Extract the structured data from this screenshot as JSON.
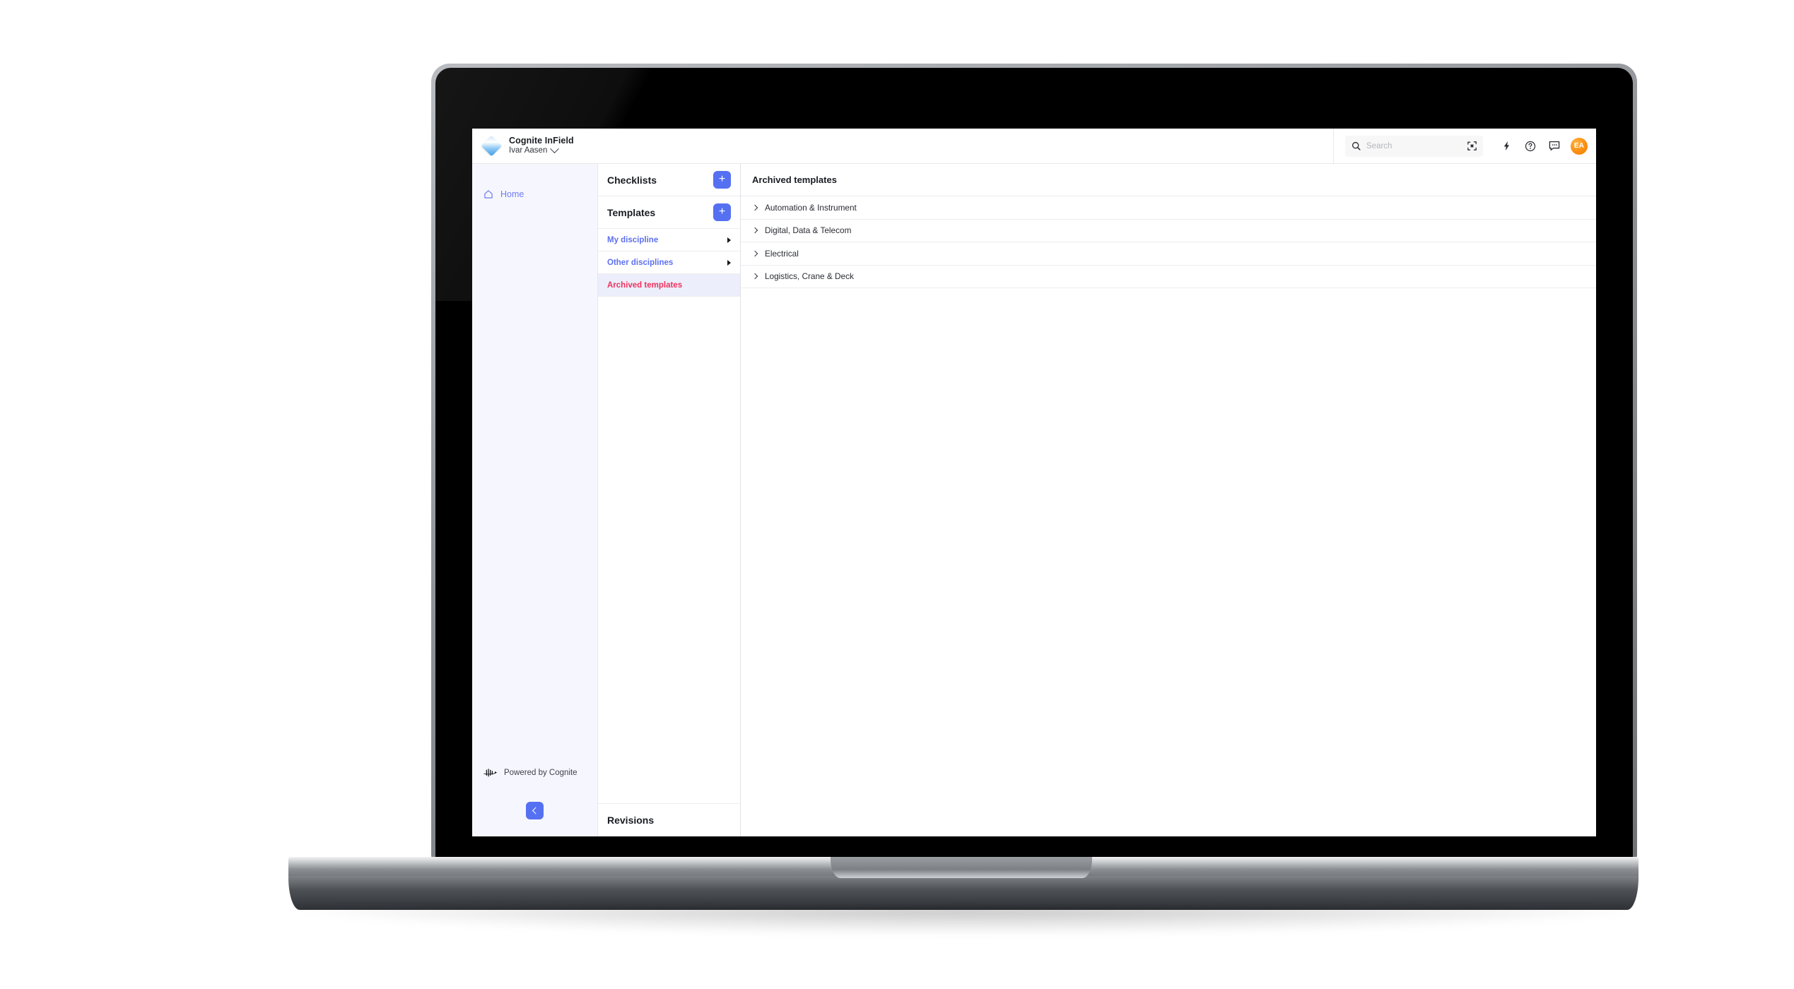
{
  "app": {
    "brand_title": "Cognite InField",
    "user_name": "Ivar Aasen",
    "user_chevron_icon": "chevron-down-icon",
    "logo_icon": "cognite-diamond-logo"
  },
  "header": {
    "search": {
      "placeholder": "Search",
      "value": "",
      "search_icon": "search-icon",
      "scan_icon": "scan-icon"
    },
    "actions": [
      {
        "name": "lightning-icon",
        "label": ""
      },
      {
        "name": "help-icon",
        "label": ""
      },
      {
        "name": "feedback-icon",
        "label": ""
      }
    ],
    "avatar_initials": "EA"
  },
  "sidebar": {
    "items": [
      {
        "label": "Home",
        "icon": "home-icon"
      }
    ],
    "footer": {
      "powered_label": "Powered by Cognite",
      "logo_icon": "cognite-mark-icon",
      "collapse_icon": "chevron-left-icon"
    }
  },
  "mid_panel": {
    "checklists": {
      "title": "Checklists",
      "add_label": "+"
    },
    "templates": {
      "title": "Templates",
      "add_label": "+"
    },
    "template_links": [
      {
        "label": "My discipline",
        "expand_icon": "triangle-right-icon",
        "active": false
      },
      {
        "label": "Other disciplines",
        "expand_icon": "triangle-right-icon",
        "active": false
      },
      {
        "label": "Archived templates",
        "expand_icon": "",
        "active": true
      }
    ],
    "revisions": {
      "title": "Revisions"
    }
  },
  "main": {
    "title": "Archived templates",
    "rows": [
      {
        "label": "Automation & Instrument",
        "expand_icon": "chevron-right-icon"
      },
      {
        "label": "Digital, Data & Telecom",
        "expand_icon": "chevron-right-icon"
      },
      {
        "label": "Electrical",
        "expand_icon": "chevron-right-icon"
      },
      {
        "label": "Logistics, Crane & Deck",
        "expand_icon": "chevron-right-icon"
      }
    ]
  },
  "colors": {
    "accent_blue": "#5570f1",
    "link_blue": "#5d70ef",
    "active_red": "#f0325c",
    "active_bg": "#eceefb",
    "sidebar_bg": "#f6f7fe",
    "avatar_orange": "#fb9416"
  }
}
